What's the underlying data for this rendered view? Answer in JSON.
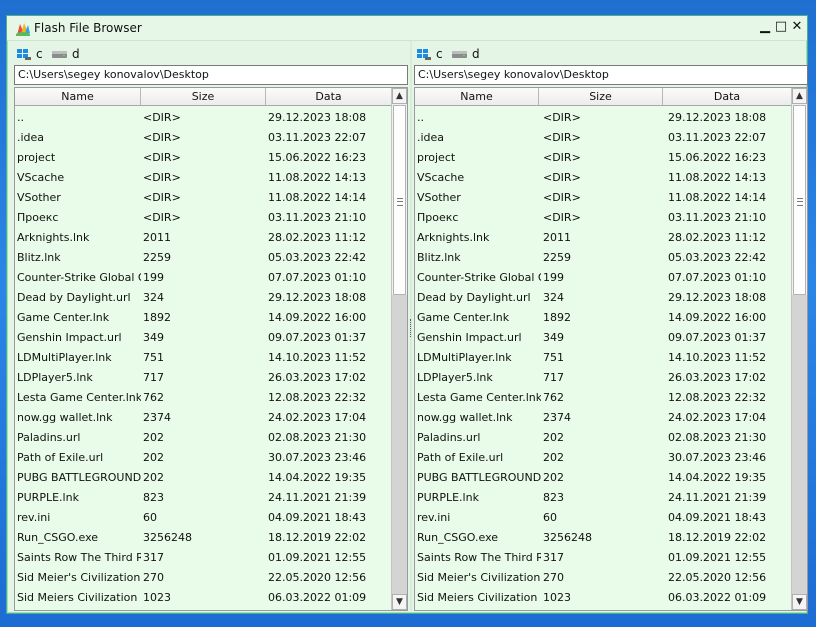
{
  "window": {
    "title": "Flash File Browser",
    "controls": {
      "minimize": "▁",
      "maximize": "□",
      "close": "✕"
    }
  },
  "panes": [
    {
      "drives": [
        {
          "label": "c",
          "icon": "windows-drive-icon"
        },
        {
          "label": "d",
          "icon": "drive-icon"
        }
      ],
      "path": "C:\\Users\\segey konovalov\\Desktop",
      "columns": [
        "Name",
        "Size",
        "Data"
      ],
      "files": [
        {
          "name": "..",
          "size": "<DIR>",
          "date": "29.12.2023  18:08"
        },
        {
          "name": ".idea",
          "size": "<DIR>",
          "date": "03.11.2023  22:07"
        },
        {
          "name": "project",
          "size": "<DIR>",
          "date": "15.06.2022  16:23"
        },
        {
          "name": "VScache",
          "size": "<DIR>",
          "date": "11.08.2022  14:13"
        },
        {
          "name": "VSother",
          "size": "<DIR>",
          "date": "11.08.2022  14:14"
        },
        {
          "name": "Проекс",
          "size": "<DIR>",
          "date": "03.11.2023  21:10"
        },
        {
          "name": "Arknights.lnk",
          "size": "2011",
          "date": "28.02.2023  11:12"
        },
        {
          "name": "Blitz.lnk",
          "size": "2259",
          "date": "05.03.2023  22:42"
        },
        {
          "name": "Counter-Strike Global Offe",
          "size": "199",
          "date": "07.07.2023  01:10"
        },
        {
          "name": "Dead by Daylight.url",
          "size": "324",
          "date": "29.12.2023  18:08"
        },
        {
          "name": "Game Center.lnk",
          "size": "1892",
          "date": "14.09.2022  16:00"
        },
        {
          "name": "Genshin Impact.url",
          "size": "349",
          "date": "09.07.2023  01:37"
        },
        {
          "name": "LDMultiPlayer.lnk",
          "size": "751",
          "date": "14.10.2023  11:52"
        },
        {
          "name": "LDPlayer5.lnk",
          "size": "717",
          "date": "26.03.2023  17:02"
        },
        {
          "name": "Lesta Game Center.lnk",
          "size": "762",
          "date": "12.08.2023  22:32"
        },
        {
          "name": "now.gg wallet.lnk",
          "size": "2374",
          "date": "24.02.2023  17:04"
        },
        {
          "name": "Paladins.url",
          "size": "202",
          "date": "02.08.2023  21:30"
        },
        {
          "name": "Path of Exile.url",
          "size": "202",
          "date": "30.07.2023  23:46"
        },
        {
          "name": "PUBG BATTLEGROUNDS.u",
          "size": "202",
          "date": "14.04.2022  19:35"
        },
        {
          "name": "PURPLE.lnk",
          "size": "823",
          "date": "24.11.2021  21:39"
        },
        {
          "name": "rev.ini",
          "size": "60",
          "date": "04.09.2021  18:43"
        },
        {
          "name": "Run_CSGO.exe",
          "size": "3256248",
          "date": "18.12.2019  22:02"
        },
        {
          "name": "Saints Row The Third Rem",
          "size": "317",
          "date": "01.09.2021  12:55"
        },
        {
          "name": "Sid Meier's Civilization VI.u",
          "size": "270",
          "date": "22.05.2020  12:56"
        },
        {
          "name": "Sid Meiers Civilization V Th",
          "size": "1023",
          "date": "06.03.2022  01:09"
        }
      ]
    },
    {
      "drives": [
        {
          "label": "c",
          "icon": "windows-drive-icon"
        },
        {
          "label": "d",
          "icon": "drive-icon"
        }
      ],
      "path": "C:\\Users\\segey konovalov\\Desktop",
      "columns": [
        "Name",
        "Size",
        "Data"
      ],
      "files": [
        {
          "name": "..",
          "size": "<DIR>",
          "date": "29.12.2023  18:08"
        },
        {
          "name": ".idea",
          "size": "<DIR>",
          "date": "03.11.2023  22:07"
        },
        {
          "name": "project",
          "size": "<DIR>",
          "date": "15.06.2022  16:23"
        },
        {
          "name": "VScache",
          "size": "<DIR>",
          "date": "11.08.2022  14:13"
        },
        {
          "name": "VSother",
          "size": "<DIR>",
          "date": "11.08.2022  14:14"
        },
        {
          "name": "Проекс",
          "size": "<DIR>",
          "date": "03.11.2023  21:10"
        },
        {
          "name": "Arknights.lnk",
          "size": "2011",
          "date": "28.02.2023  11:12"
        },
        {
          "name": "Blitz.lnk",
          "size": "2259",
          "date": "05.03.2023  22:42"
        },
        {
          "name": "Counter-Strike Global Off",
          "size": "199",
          "date": "07.07.2023  01:10"
        },
        {
          "name": "Dead by Daylight.url",
          "size": "324",
          "date": "29.12.2023  18:08"
        },
        {
          "name": "Game Center.lnk",
          "size": "1892",
          "date": "14.09.2022  16:00"
        },
        {
          "name": "Genshin Impact.url",
          "size": "349",
          "date": "09.07.2023  01:37"
        },
        {
          "name": "LDMultiPlayer.lnk",
          "size": "751",
          "date": "14.10.2023  11:52"
        },
        {
          "name": "LDPlayer5.lnk",
          "size": "717",
          "date": "26.03.2023  17:02"
        },
        {
          "name": "Lesta Game Center.lnk",
          "size": "762",
          "date": "12.08.2023  22:32"
        },
        {
          "name": "now.gg wallet.lnk",
          "size": "2374",
          "date": "24.02.2023  17:04"
        },
        {
          "name": "Paladins.url",
          "size": "202",
          "date": "02.08.2023  21:30"
        },
        {
          "name": "Path of Exile.url",
          "size": "202",
          "date": "30.07.2023  23:46"
        },
        {
          "name": "PUBG BATTLEGROUNDS.u",
          "size": "202",
          "date": "14.04.2022  19:35"
        },
        {
          "name": "PURPLE.lnk",
          "size": "823",
          "date": "24.11.2021  21:39"
        },
        {
          "name": "rev.ini",
          "size": "60",
          "date": "04.09.2021  18:43"
        },
        {
          "name": "Run_CSGO.exe",
          "size": "3256248",
          "date": "18.12.2019  22:02"
        },
        {
          "name": "Saints Row The Third Ren",
          "size": "317",
          "date": "01.09.2021  12:55"
        },
        {
          "name": "Sid Meier's Civilization VI.u",
          "size": "270",
          "date": "22.05.2020  12:56"
        },
        {
          "name": "Sid Meiers Civilization V Th",
          "size": "1023",
          "date": "06.03.2022  01:09"
        }
      ]
    }
  ]
}
